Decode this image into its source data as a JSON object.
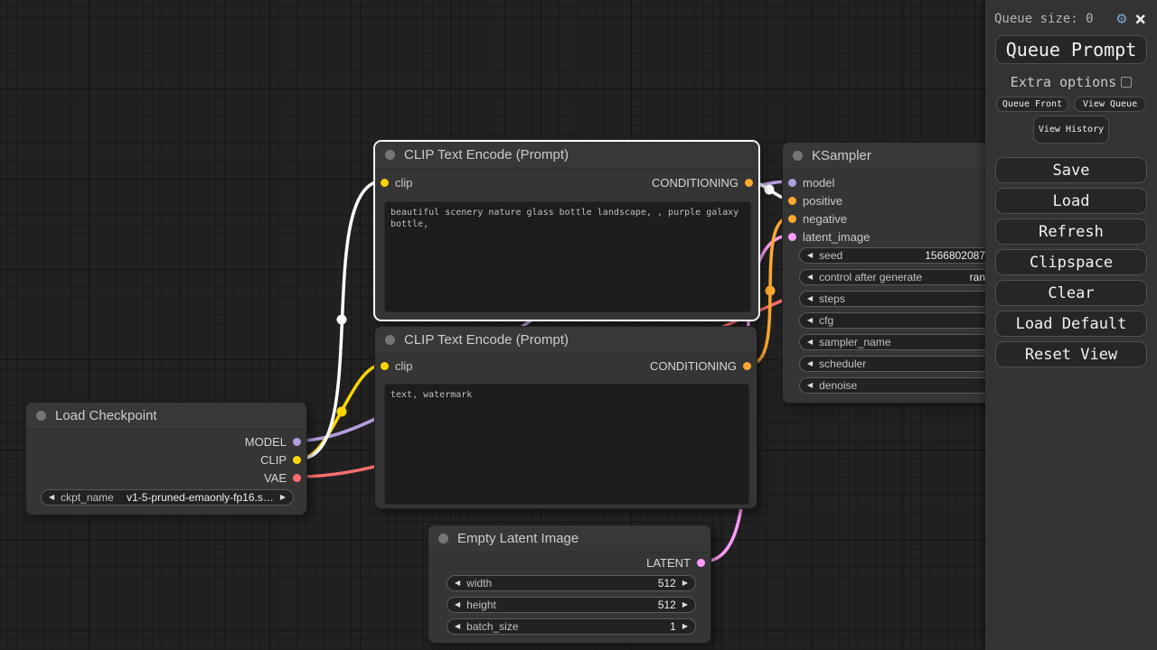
{
  "colors": {
    "model": "#B39DDB",
    "clip": "#FFD500",
    "vae": "#FF6E6E",
    "conditioning": "#FFA931",
    "latent": "#FF9CF9",
    "link_highlight": "#FFFFFF",
    "gear_accent": "#74A7C9"
  },
  "icons": {
    "stepper_left": "◀",
    "stepper_right": "▶",
    "gear": "⚙",
    "close": "×"
  },
  "sidebar": {
    "queue_size_label": "Queue size: 0",
    "queue_prompt": "Queue Prompt",
    "extra_options": "Extra options",
    "queue_front": "Queue Front",
    "view_queue": "View Queue",
    "view_history": "View History",
    "buttons": [
      {
        "label": "Save"
      },
      {
        "label": "Load"
      },
      {
        "label": "Refresh"
      },
      {
        "label": "Clipspace"
      },
      {
        "label": "Clear"
      },
      {
        "label": "Load Default"
      },
      {
        "label": "Reset View"
      }
    ]
  },
  "nodes": {
    "clip_encode_1": {
      "title": "CLIP Text Encode (Prompt)",
      "input": "clip",
      "output": "CONDITIONING",
      "text": "beautiful scenery nature glass bottle landscape, , purple galaxy bottle,"
    },
    "clip_encode_2": {
      "title": "CLIP Text Encode (Prompt)",
      "input": "clip",
      "output": "CONDITIONING",
      "text": "text, watermark"
    },
    "load_checkpoint": {
      "title": "Load Checkpoint",
      "outputs": [
        {
          "label": "MODEL"
        },
        {
          "label": "CLIP"
        },
        {
          "label": "VAE"
        }
      ],
      "widget": {
        "label": "ckpt_name",
        "value": "v1-5-pruned-emaonly-fp16.s…"
      }
    },
    "ksampler": {
      "title": "KSampler",
      "inputs": [
        {
          "label": "model"
        },
        {
          "label": "positive"
        },
        {
          "label": "negative"
        },
        {
          "label": "latent_image"
        }
      ],
      "widgets": [
        {
          "label": "seed",
          "value": "1566802087"
        },
        {
          "label": "control after generate",
          "value": "ran"
        },
        {
          "label": "steps",
          "value": ""
        },
        {
          "label": "cfg",
          "value": ""
        },
        {
          "label": "sampler_name",
          "value": ""
        },
        {
          "label": "scheduler",
          "value": ""
        },
        {
          "label": "denoise",
          "value": ""
        }
      ]
    },
    "empty_latent": {
      "title": "Empty Latent Image",
      "output": "LATENT",
      "widgets": [
        {
          "label": "width",
          "value": "512"
        },
        {
          "label": "height",
          "value": "512"
        },
        {
          "label": "batch_size",
          "value": "1"
        }
      ]
    }
  }
}
